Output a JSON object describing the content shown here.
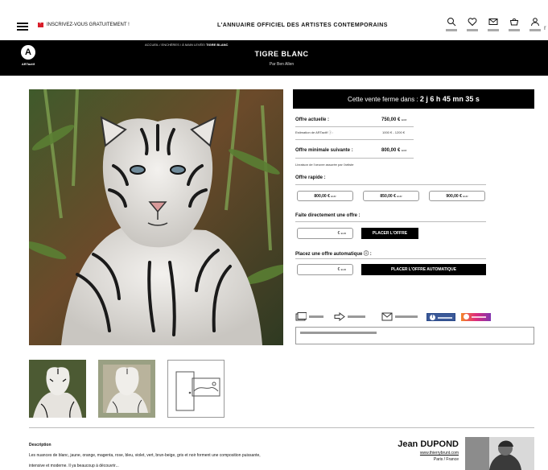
{
  "topbar": {
    "register_label": "INSCRIVEZ-VOUS GRATUITEMENT !",
    "site_title": "L'ANNUAIRE OFFICIEL DES ARTISTES CONTEMPORAINS",
    "overflow_char": "r",
    "icons": [
      "search-icon",
      "heart-icon",
      "mail-icon",
      "cart-icon",
      "user-icon"
    ]
  },
  "header": {
    "logo_letter": "A",
    "logo_brand": "ARTactif",
    "breadcrumb_prefix": "ACCUEIL / ENCHÈRES / À MAIN LEVÉE/ ",
    "breadcrumb_current": "TIGRE BLANC",
    "title": "TIGRE BLANC",
    "artist": "Par Ben Allen"
  },
  "auction": {
    "countdown_label": "Cette vente ferme dans :",
    "countdown_value": "2 j  6 h  45 mn  35 s",
    "current_offer_label": "Offre actuelle :",
    "current_offer_value": "750,00 €",
    "estimate_label": "Estimation de ARTactif",
    "estimate_value": "1000 € - 1200 €",
    "min_offer_label": "Offre minimale suivante :",
    "min_offer_value": "800,00 €",
    "delivery_note": "Livraison de l'oeuvre assurée par l'artiste",
    "quick_label": "Offre rapide :",
    "quick_offers": [
      "800,00 €",
      "850,00 €",
      "900,00 €"
    ],
    "unit": "EUR",
    "direct_label": "Faite directement une offre :",
    "direct_input_value": "€",
    "direct_button": "PLACER L'OFFRE",
    "auto_label": "Placez une offre automatique",
    "auto_input_value": "€",
    "auto_button": "PLACER L'OFFRE AUTOMATIQUE",
    "info_icon": "info-icon"
  },
  "share": {
    "icons": [
      "save-folder-icon",
      "share-arrow-icon",
      "email-icon",
      "facebook-icon",
      "instagram-icon"
    ],
    "facebook_letter": "f"
  },
  "description": {
    "title": "Description",
    "text_line1": "Les nuances de blanc, jaune, orange, magenta, rose, bleu, violet, vert, brun-beige, gris et noir forment une composition puissante,",
    "text_line2": "intensive et moderne. Il ya beaucoup à découvrir..."
  },
  "artist": {
    "name": "Jean DUPOND",
    "website": "www.thierrybrunt.com",
    "location": "Paris / France"
  },
  "colors": {
    "black": "#000000",
    "facebook": "#3b5998",
    "instagram_from": "#f58529",
    "instagram_to": "#8134af",
    "flag_red": "#d81e2a"
  }
}
